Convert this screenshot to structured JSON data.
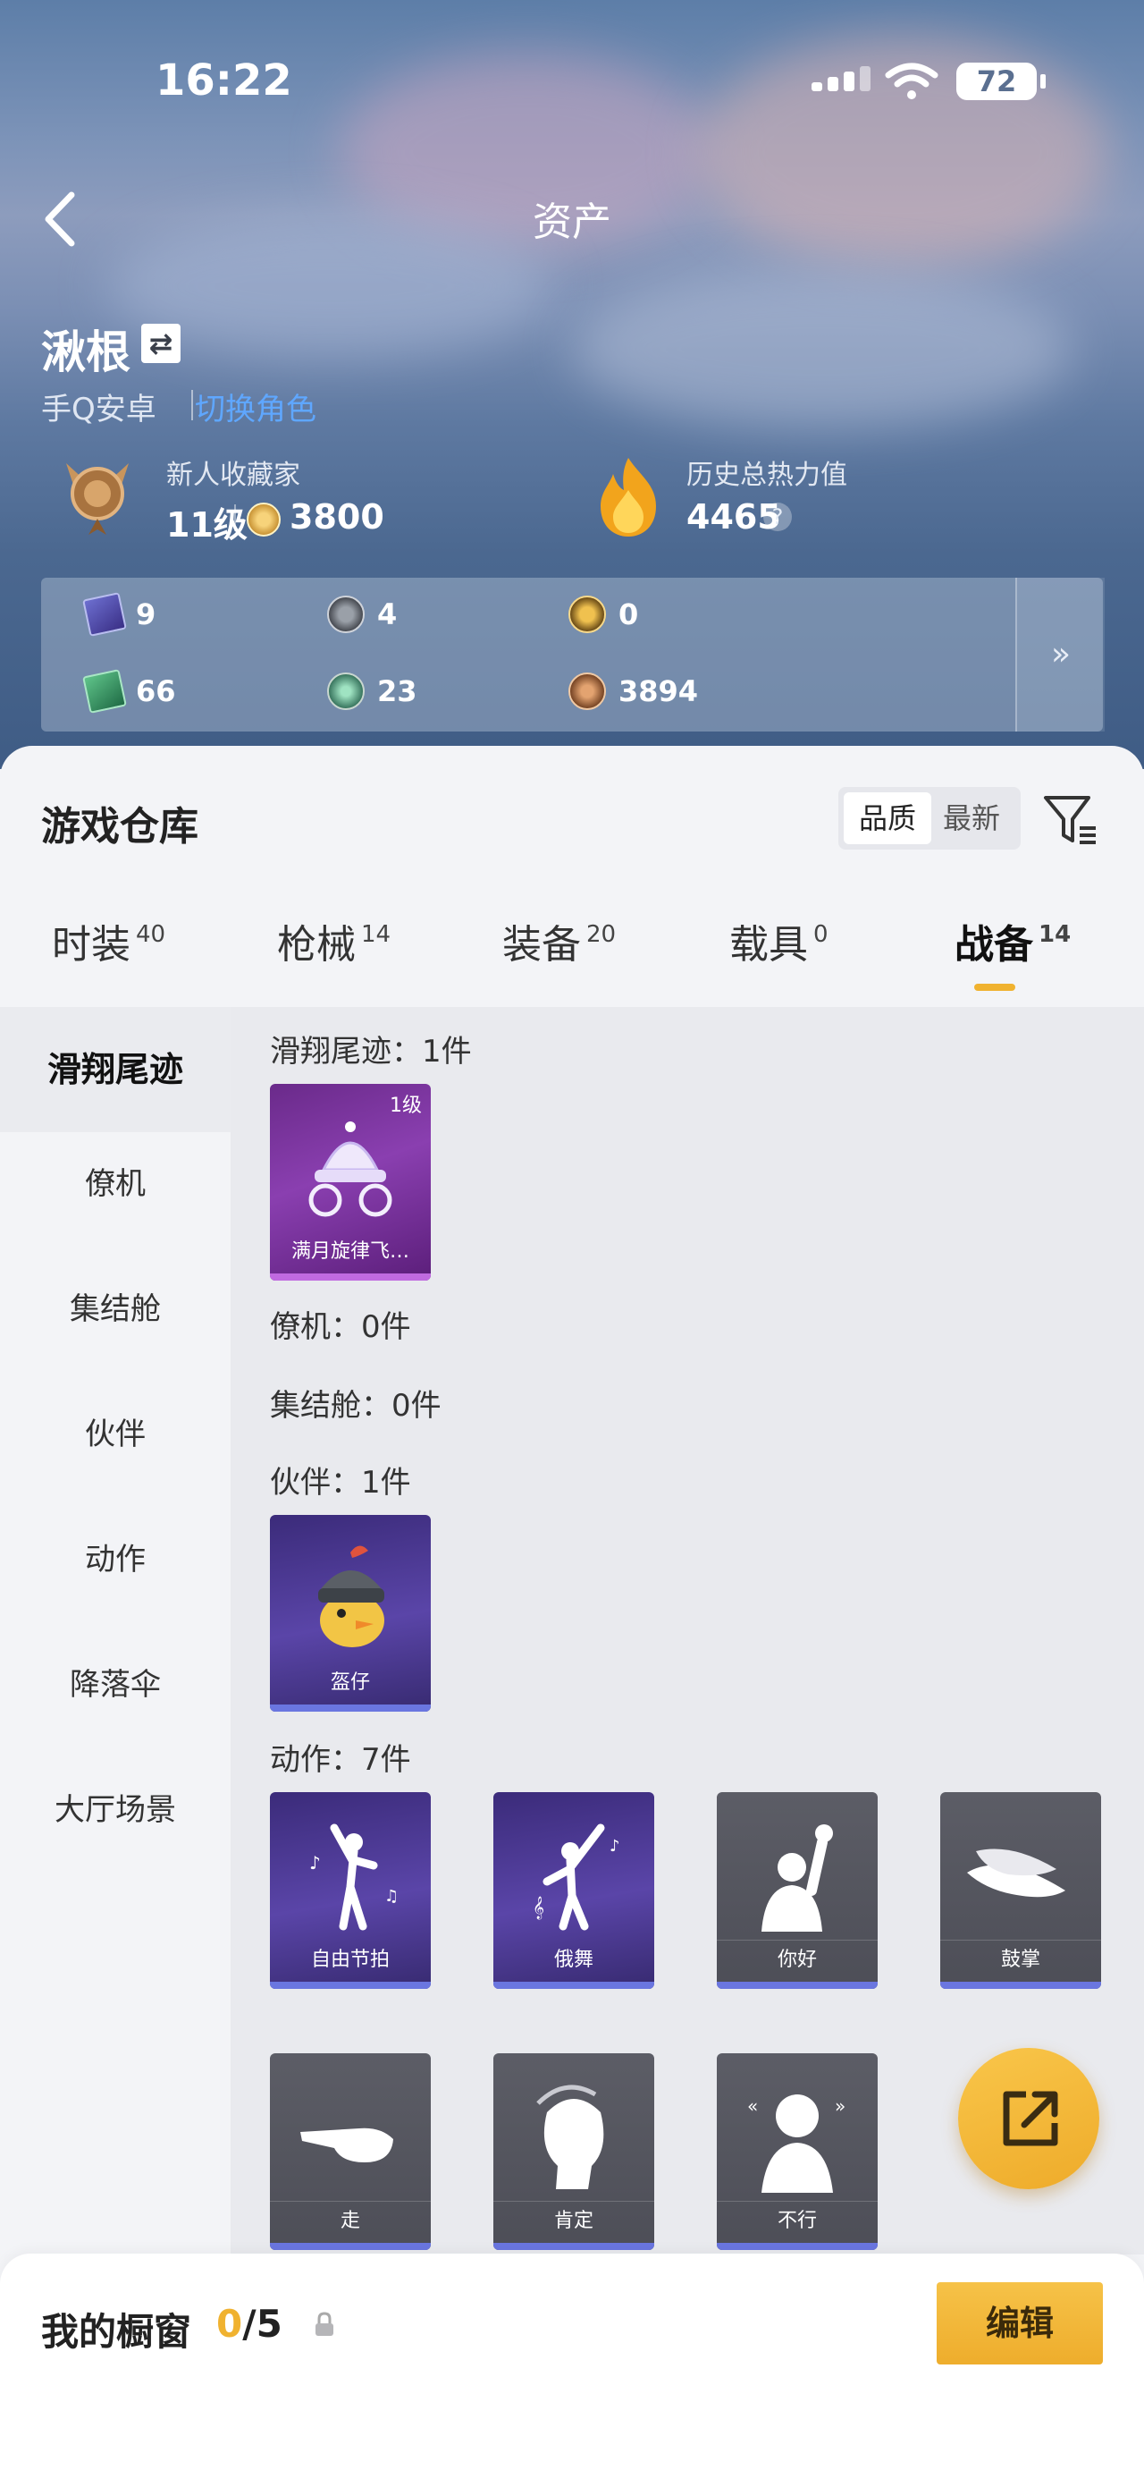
{
  "status_bar": {
    "time": "16:22",
    "battery": "72"
  },
  "nav": {
    "title": "资产"
  },
  "profile": {
    "name": "湫根",
    "swap_icon": "⇄",
    "platform": "手Q安卓",
    "platform_link": "切换角色",
    "collector_title": "新人收藏家",
    "collector_level": "11级",
    "collector_points": "3800",
    "heat_title": "历史总热力值",
    "heat_value": "4465",
    "heat_help": "?"
  },
  "stats": {
    "items": [
      {
        "icon": "purple-card-icon",
        "value": "9"
      },
      {
        "icon": "silver-coin-icon",
        "value": "4"
      },
      {
        "icon": "gold-coin-icon",
        "value": "0"
      },
      {
        "icon": "green-card-icon",
        "value": "66"
      },
      {
        "icon": "green-orb-icon",
        "value": "23"
      },
      {
        "icon": "bronze-coin-icon",
        "value": "3894"
      }
    ],
    "more": "»"
  },
  "warehouse": {
    "title": "游戏仓库",
    "sort_quality": "品质",
    "sort_latest": "最新",
    "tabs": [
      {
        "label": "时装",
        "count": "40"
      },
      {
        "label": "枪械",
        "count": "14"
      },
      {
        "label": "装备",
        "count": "20"
      },
      {
        "label": "载具",
        "count": "0"
      },
      {
        "label": "战备",
        "count": "14"
      }
    ],
    "active_tab": "战备"
  },
  "sidebar": {
    "items": [
      "滑翔尾迹",
      "僚机",
      "集结舱",
      "伙伴",
      "动作",
      "降落伞",
      "大厅场景"
    ]
  },
  "sections": {
    "glide": {
      "label": "滑翔尾迹：1件",
      "items": [
        {
          "name": "满月旋律飞…",
          "level": "1级"
        }
      ]
    },
    "wingman": {
      "label": "僚机：0件"
    },
    "capsule": {
      "label": "集结舱：0件"
    },
    "partner": {
      "label": "伙伴：1件",
      "items": [
        {
          "name": "盔仔"
        }
      ]
    },
    "emote": {
      "label": "动作：7件",
      "items": [
        {
          "name": "自由节拍"
        },
        {
          "name": "俄舞"
        },
        {
          "name": "你好"
        },
        {
          "name": "鼓掌"
        },
        {
          "name": "走"
        },
        {
          "name": "肯定"
        },
        {
          "name": "不行"
        }
      ]
    }
  },
  "showcase": {
    "title": "我的橱窗",
    "count_current": "0",
    "count_sep": "/",
    "count_total": "5",
    "edit": "编辑"
  },
  "colors": {
    "accent": "#f0b230",
    "link": "#5fa7ff",
    "purple_bar": "#c06ae0",
    "blue_bar": "#6a76e0"
  }
}
